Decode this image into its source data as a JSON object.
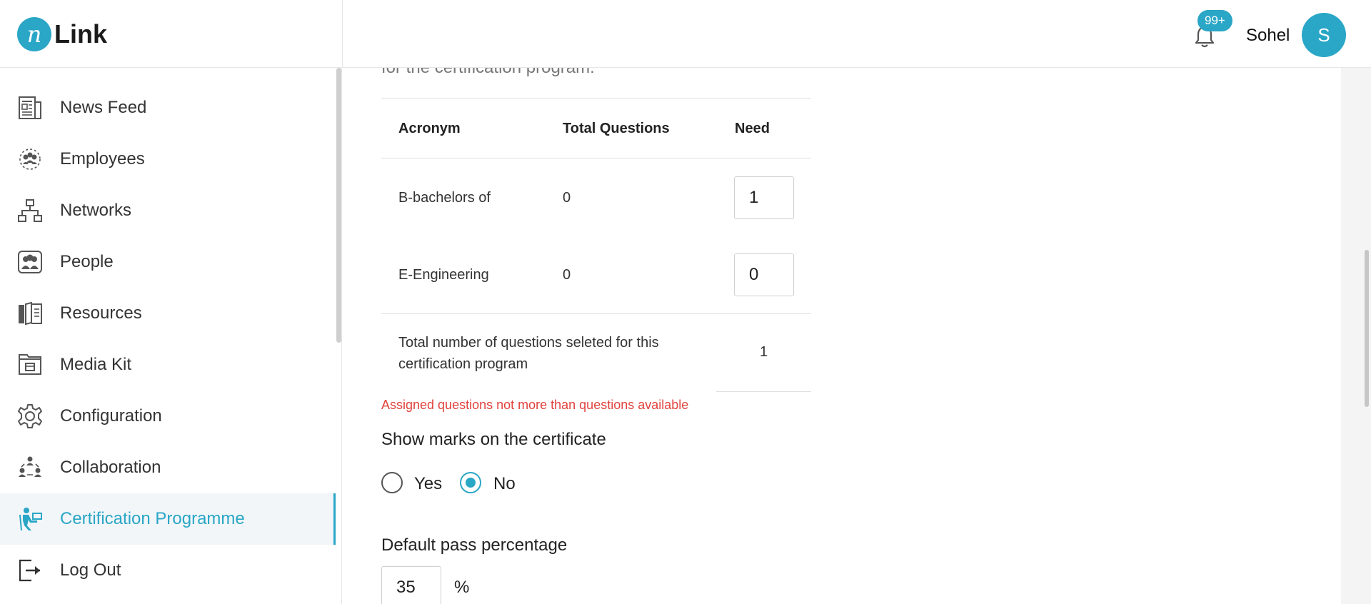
{
  "header": {
    "logo_mark": "n",
    "logo_text": "Link",
    "notification_count": "99+",
    "username": "Sohel",
    "avatar_initial": "S"
  },
  "sidebar": {
    "items": [
      {
        "label": "News Feed",
        "icon": "newspaper-icon"
      },
      {
        "label": "Employees",
        "icon": "employees-icon"
      },
      {
        "label": "Networks",
        "icon": "network-icon"
      },
      {
        "label": "People",
        "icon": "people-icon"
      },
      {
        "label": "Resources",
        "icon": "book-icon"
      },
      {
        "label": "Media Kit",
        "icon": "media-kit-icon"
      },
      {
        "label": "Configuration",
        "icon": "gear-icon"
      },
      {
        "label": "Collaboration",
        "icon": "collaboration-icon"
      },
      {
        "label": "Certification Programme",
        "icon": "certification-icon",
        "active": true
      },
      {
        "label": "Log Out",
        "icon": "logout-icon"
      }
    ]
  },
  "main": {
    "clipped_intro": "for the certification program.",
    "table": {
      "headers": [
        "Acronym",
        "Total Questions",
        "Need"
      ],
      "rows": [
        {
          "acronym": "B-bachelors of",
          "total": "0",
          "need": "1"
        },
        {
          "acronym": "E-Engineering",
          "total": "0",
          "need": "0"
        }
      ],
      "total_label": "Total number of questions seleted for this certification program",
      "total_value": "1"
    },
    "error_message": "Assigned questions not more than questions available",
    "show_marks": {
      "label": "Show marks on the certificate",
      "options": [
        "Yes",
        "No"
      ],
      "selected": "No"
    },
    "pass_percentage": {
      "label": "Default pass percentage",
      "value": "35",
      "unit": "%"
    }
  },
  "colors": {
    "accent": "#2aa6c6",
    "error": "#e0413b"
  }
}
